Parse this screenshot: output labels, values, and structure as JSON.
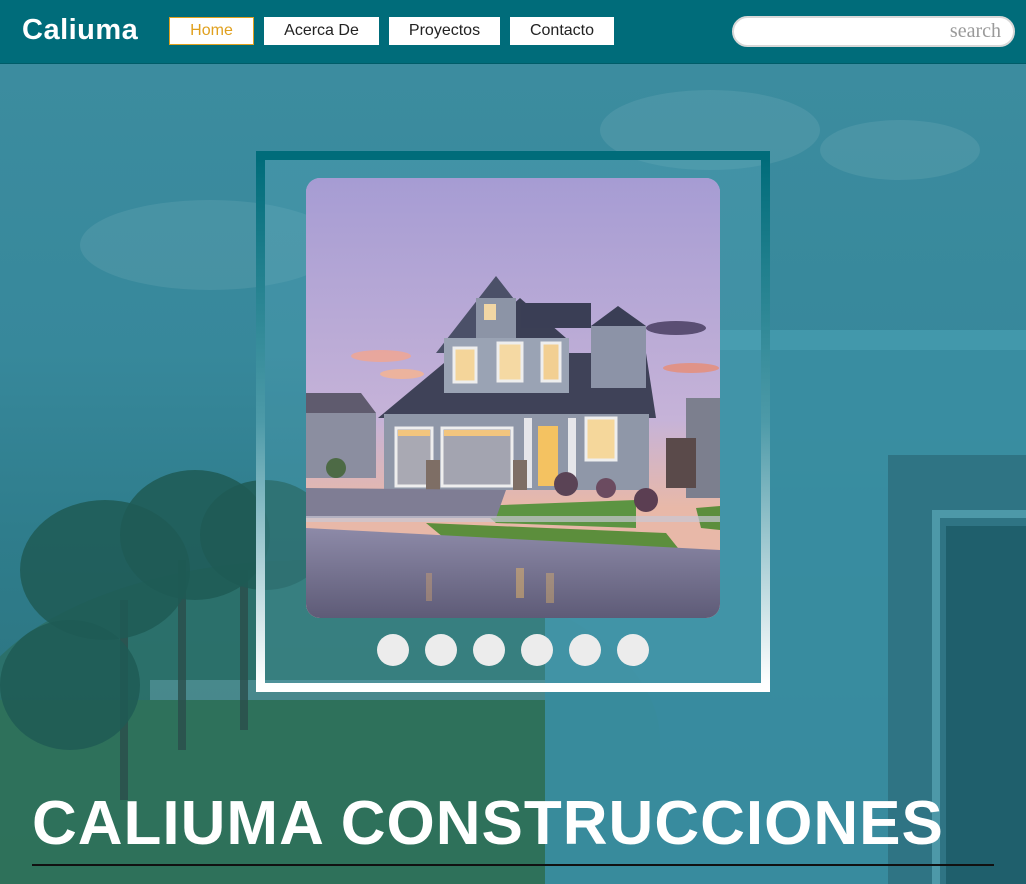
{
  "brand": {
    "name": "Caliuma"
  },
  "nav": {
    "items": [
      {
        "label": "Home",
        "active": true
      },
      {
        "label": "Acerca De",
        "active": false
      },
      {
        "label": "Proyectos",
        "active": false
      },
      {
        "label": "Contacto",
        "active": false
      }
    ]
  },
  "search": {
    "placeholder": "search",
    "value": ""
  },
  "slider": {
    "image": "house-photo",
    "dot_count": 6,
    "active_dot": 1
  },
  "hero": {
    "title": "CALIUMA CONSTRUCCIONES"
  },
  "colors": {
    "nav_bg": "#006c7a",
    "accent": "#e0a01e",
    "overlay": "#3d8da0",
    "text_light": "#ffffff"
  }
}
